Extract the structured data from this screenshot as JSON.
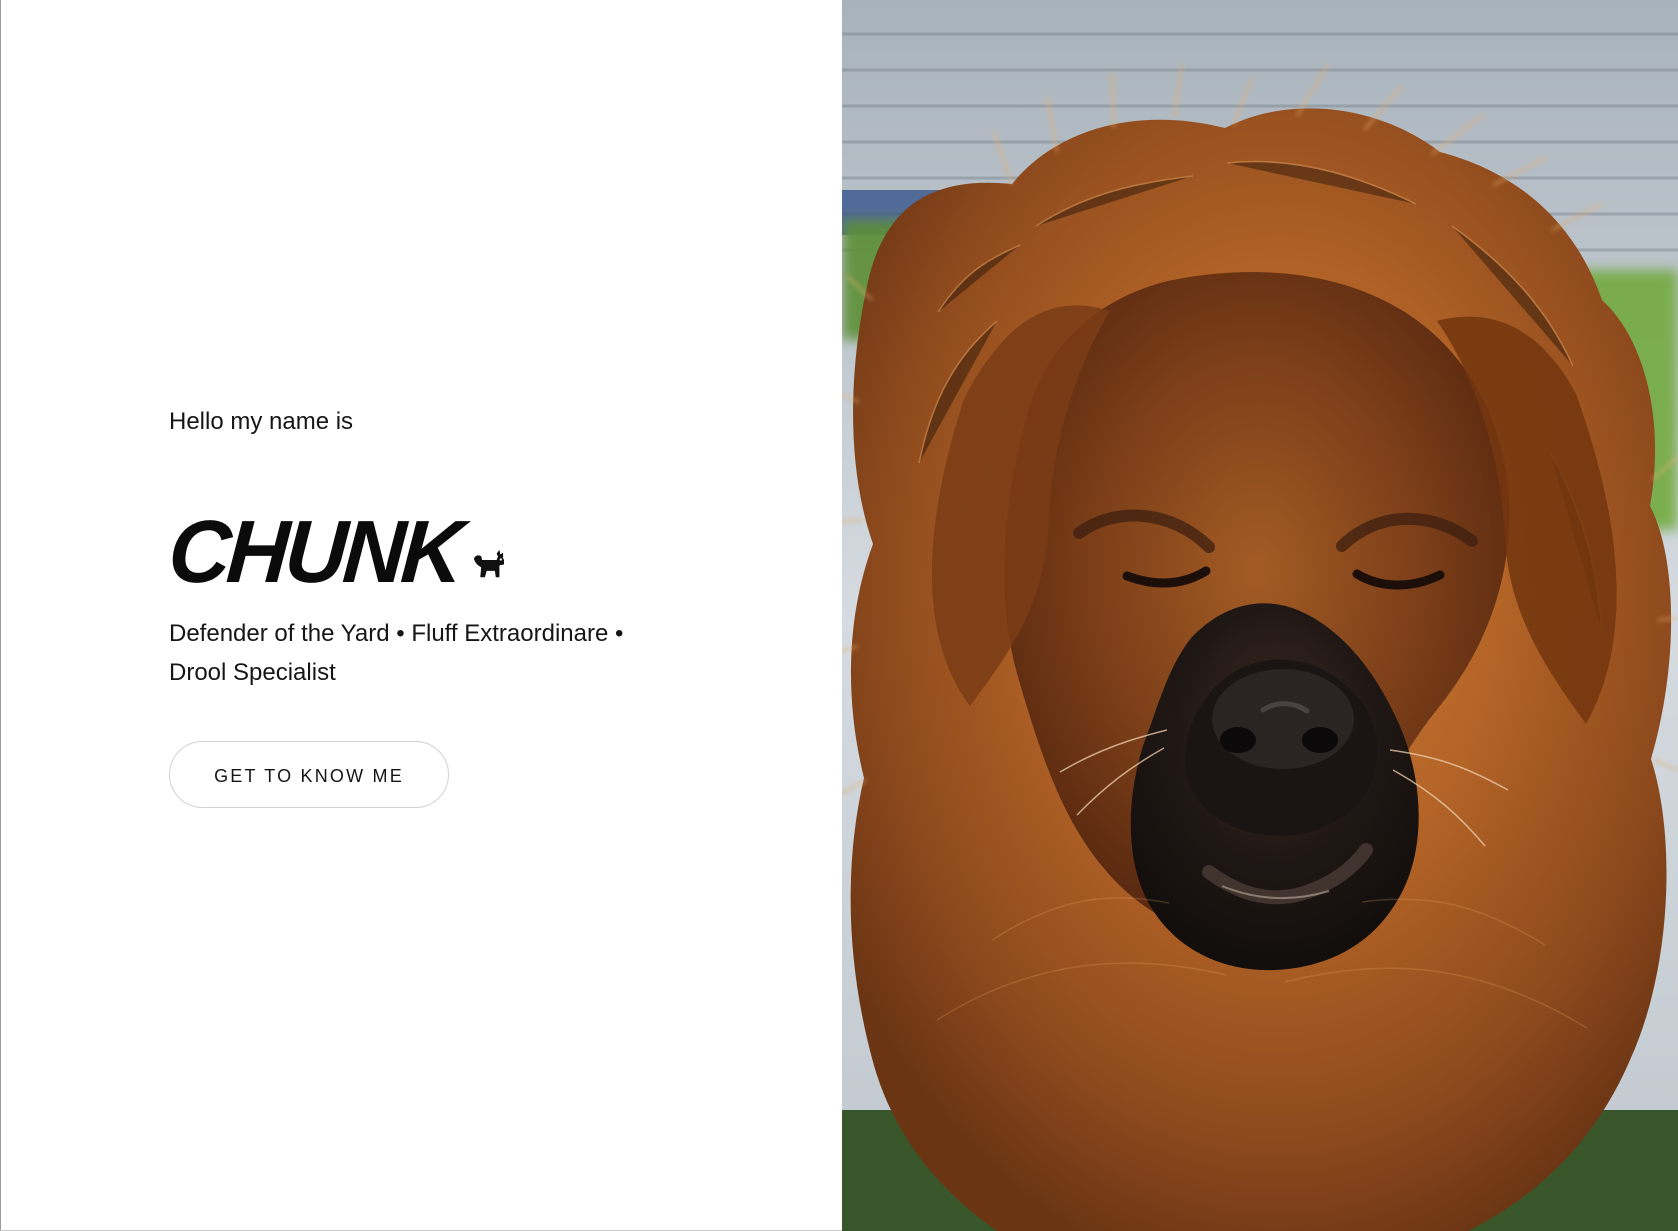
{
  "hero": {
    "greeting": "Hello my name is",
    "name": "CHUNK",
    "name_icon": "dog-icon",
    "tagline": "Defender of the Yard • Fluff Extraordinare • Drool Specialist",
    "button_label": "GET TO KNOW ME"
  },
  "photo": {
    "subject": "dog-photo"
  },
  "colors": {
    "background": "#ffffff",
    "text": "#111111",
    "button_border": "#d2d2d2",
    "fur_primary": "#b86b2b",
    "fur_dark": "#6b3514",
    "muzzle": "#1d1714",
    "grass": "#5d8f36",
    "wall": "#cfd6dc"
  }
}
